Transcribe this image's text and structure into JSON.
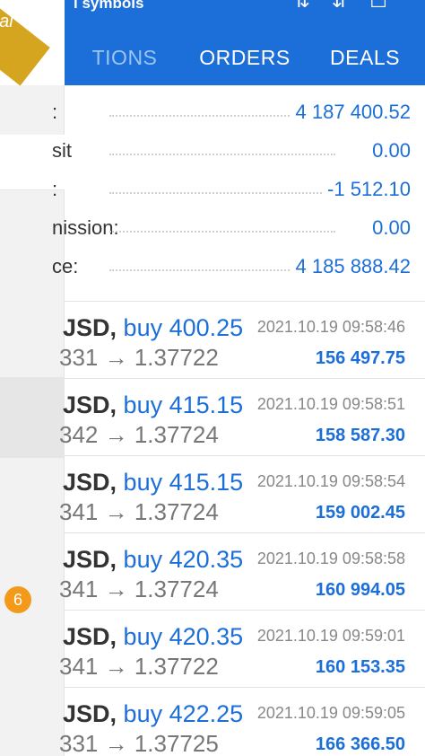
{
  "drawer": {
    "ribbon_text": "al",
    "badge_count": "6"
  },
  "appbar": {
    "title": "l symbols",
    "icons": [
      "arrows-icon",
      "sort-icon",
      "new-order-icon"
    ],
    "tabs": [
      {
        "label": "TIONS",
        "active": true
      },
      {
        "label": "ORDERS",
        "active": false
      },
      {
        "label": "DEALS",
        "active": false
      }
    ]
  },
  "summary": [
    {
      "label": ":",
      "value": "4 187 400.52"
    },
    {
      "label": "sit",
      "value": "0.00"
    },
    {
      "label": ":",
      "value": "-1 512.10"
    },
    {
      "label": "nission:",
      "value": "0.00"
    },
    {
      "label": "ce:",
      "value": "4 185 888.42"
    }
  ],
  "deals": [
    {
      "symbol": "JSD,",
      "action": "buy 400.25",
      "prices": "331 → 1.37722",
      "time": "2021.10.19 09:58:46",
      "profit": "156 497.75"
    },
    {
      "symbol": "JSD,",
      "action": "buy 415.15",
      "prices": "342 → 1.37724",
      "time": "2021.10.19 09:58:51",
      "profit": "158 587.30"
    },
    {
      "symbol": "JSD,",
      "action": "buy 415.15",
      "prices": "341 → 1.37724",
      "time": "2021.10.19 09:58:54",
      "profit": "159 002.45"
    },
    {
      "symbol": "JSD,",
      "action": "buy 420.35",
      "prices": "341 → 1.37724",
      "time": "2021.10.19 09:58:58",
      "profit": "160 994.05"
    },
    {
      "symbol": "JSD,",
      "action": "buy 420.35",
      "prices": "341 → 1.37722",
      "time": "2021.10.19 09:59:01",
      "profit": "160 153.35"
    },
    {
      "symbol": "JSD,",
      "action": "buy 422.25",
      "prices": "331 → 1.37725",
      "time": "2021.10.19 09:59:05",
      "profit": "166 366.50"
    }
  ],
  "colors": {
    "accent": "#1c6fd8",
    "ribbon": "#d6a520",
    "badge": "#f39a1b"
  }
}
